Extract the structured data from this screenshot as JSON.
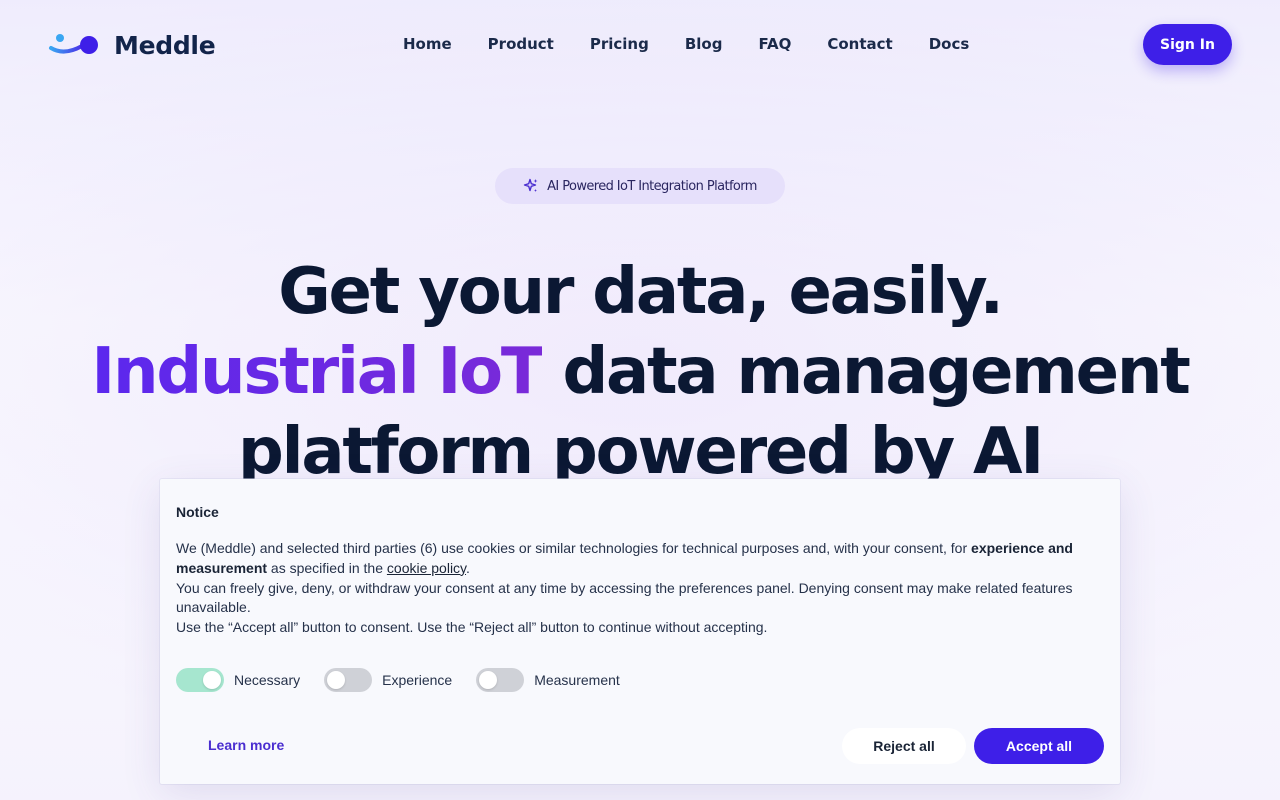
{
  "brand": {
    "name": "Meddle",
    "logo_icon": "meddle-logo-icon",
    "accent_color": "#3e1fe8"
  },
  "nav": {
    "links": [
      "Home",
      "Product",
      "Pricing",
      "Blog",
      "FAQ",
      "Contact",
      "Docs"
    ],
    "signin_label": "Sign In"
  },
  "hero": {
    "badge_icon": "sparkles-icon",
    "badge_text": "AI Powered IoT Integration Platform",
    "line1": "Get your data, easily.",
    "line2_highlight": "Industrial IoT",
    "line2_rest": " data management",
    "line3": "platform powered by AI",
    "highlight_color_start": "#5b28ee",
    "highlight_color_end": "#7a2ad8"
  },
  "cookie": {
    "title": "Notice",
    "p1_before": "We (Meddle) and selected third parties (6) use cookies or similar technologies for technical purposes and, with your consent, for ",
    "p1_bold": "experience and measurement",
    "p1_mid": " as specified in the ",
    "p1_link": "cookie policy",
    "p1_end": ".",
    "p2": "You can freely give, deny, or withdraw your consent at any time by accessing the preferences panel. Denying consent may make related features unavailable.",
    "p3": "Use the “Accept all” button to consent. Use the “Reject all” button to continue without accepting.",
    "toggles": [
      {
        "label": "Necessary",
        "on": true
      },
      {
        "label": "Experience",
        "on": false
      },
      {
        "label": "Measurement",
        "on": false
      }
    ],
    "toggle_on_color": "#a6e6cf",
    "learn_more": "Learn more",
    "reject_label": "Reject all",
    "accept_label": "Accept all"
  }
}
